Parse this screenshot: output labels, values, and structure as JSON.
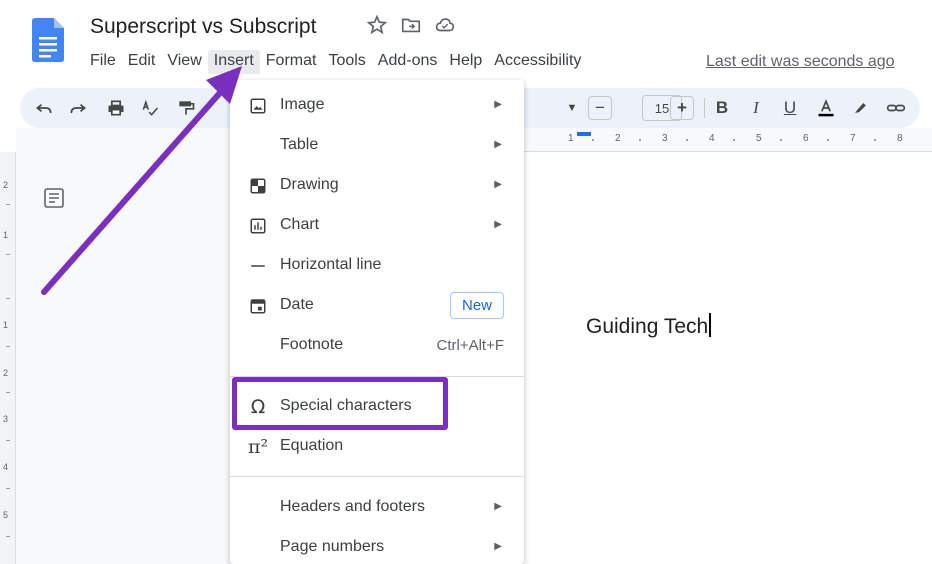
{
  "app": {
    "doc_title": "Superscript vs Subscript",
    "last_edit": "Last edit was seconds ago"
  },
  "menubar": {
    "items": [
      "File",
      "Edit",
      "View",
      "Insert",
      "Format",
      "Tools",
      "Add-ons",
      "Help",
      "Accessibility"
    ],
    "active": "Insert"
  },
  "toolbar": {
    "font_size": "15",
    "minus": "−",
    "plus": "+"
  },
  "ruler": {
    "numbers": [
      "1",
      "2",
      "3",
      "4",
      "5",
      "6",
      "7",
      "8"
    ]
  },
  "vertical_ruler": {
    "numbers": [
      "2",
      "1",
      "1",
      "2",
      "3",
      "4",
      "5"
    ]
  },
  "document": {
    "body_text": "Guiding Tech"
  },
  "insert_menu": {
    "items": [
      {
        "label": "Image",
        "icon": "image-icon",
        "submenu": true
      },
      {
        "label": "Table",
        "icon": "",
        "submenu": true
      },
      {
        "label": "Drawing",
        "icon": "drawing-icon",
        "submenu": true
      },
      {
        "label": "Chart",
        "icon": "chart-icon",
        "submenu": true
      },
      {
        "label": "Horizontal line",
        "icon": "horizontal-line-icon",
        "submenu": false
      },
      {
        "label": "Date",
        "icon": "calendar-icon",
        "badge": "New"
      },
      {
        "label": "Footnote",
        "icon": "",
        "shortcut": "Ctrl+Alt+F"
      },
      {
        "label": "Special characters",
        "icon": "omega-icon",
        "highlighted": true
      },
      {
        "label": "Equation",
        "icon": "pi-icon"
      },
      {
        "label": "Headers and footers",
        "icon": "",
        "submenu": true
      },
      {
        "label": "Page numbers",
        "icon": "",
        "submenu": true
      }
    ]
  },
  "colors": {
    "annotation": "#7b2fbf",
    "docs_blue": "#4285f4",
    "badge_blue": "#1967d2"
  }
}
